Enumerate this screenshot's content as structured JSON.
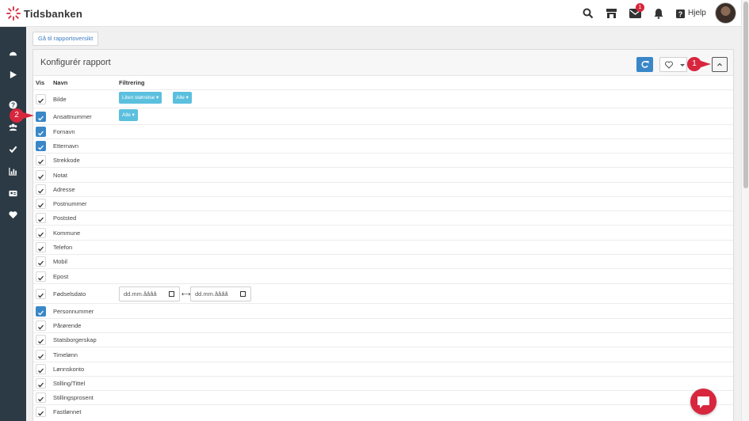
{
  "app": {
    "brand": "Tidsbanken"
  },
  "topbar": {
    "help_label": "Hjelp",
    "mail_badge": "1"
  },
  "back_button": "Gå til rapportoversikt",
  "panel": {
    "title": "Konfigurér rapport",
    "headers": {
      "show": "Vis",
      "name": "Navn",
      "filter": "Filtrering"
    }
  },
  "filters": {
    "image_size": "Liten størrelse ▾",
    "all": "Alle ▾",
    "date_placeholder": "dd.mm.åååå",
    "date_sep": "⟷"
  },
  "rows": [
    {
      "label": "Bilde",
      "checked": false
    },
    {
      "label": "Ansattnummer",
      "checked": true
    },
    {
      "label": "Fornavn",
      "checked": true
    },
    {
      "label": "Etternavn",
      "checked": true
    },
    {
      "label": "Strekkode",
      "checked": false
    },
    {
      "label": "Notat",
      "checked": false
    },
    {
      "label": "Adresse",
      "checked": false
    },
    {
      "label": "Postnummer",
      "checked": false
    },
    {
      "label": "Poststed",
      "checked": false
    },
    {
      "label": "Kommune",
      "checked": false
    },
    {
      "label": "Telefon",
      "checked": false
    },
    {
      "label": "Mobil",
      "checked": false
    },
    {
      "label": "Epost",
      "checked": false
    },
    {
      "label": "Fødselsdato",
      "checked": false
    },
    {
      "label": "Personnummer",
      "checked": true
    },
    {
      "label": "Pårørende",
      "checked": false
    },
    {
      "label": "Statsborgerskap",
      "checked": false
    },
    {
      "label": "Timelønn",
      "checked": false
    },
    {
      "label": "Lønnskonto",
      "checked": false
    },
    {
      "label": "Stilling/Tittel",
      "checked": false
    },
    {
      "label": "Stillingsprosent",
      "checked": false
    },
    {
      "label": "Fastlønnet",
      "checked": false
    }
  ],
  "callouts": {
    "one": "1",
    "two": "2"
  },
  "colors": {
    "accent": "#3a87c8",
    "info": "#5bc0de",
    "callout": "#d7263d",
    "sidebar": "#2b3a44"
  }
}
